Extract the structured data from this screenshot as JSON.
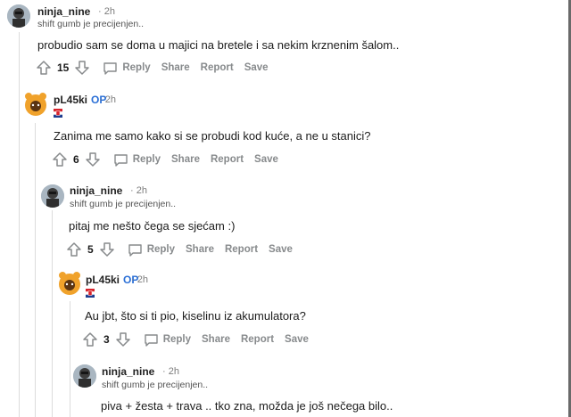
{
  "comments": [
    {
      "username": "ninja_nine",
      "op_badge": "",
      "time": "2h",
      "flair": "shift gumb je precijenjen..",
      "body": "probudio sam se doma u majici na bretele i sa nekim krznenim šalom..",
      "score": "15",
      "reply": "Reply",
      "share": "Share",
      "report": "Report",
      "save": "Save"
    },
    {
      "username": "pL45ki",
      "op_badge": "OP",
      "time": "2h",
      "flair": "",
      "body": "Zanima me samo kako si se probudi kod kuće, a ne u stanici?",
      "score": "6",
      "reply": "Reply",
      "share": "Share",
      "report": "Report",
      "save": "Save"
    },
    {
      "username": "ninja_nine",
      "op_badge": "",
      "time": "2h",
      "flair": "shift gumb je precijenjen..",
      "body": "pitaj me nešto čega se sjećam :)",
      "score": "5",
      "reply": "Reply",
      "share": "Share",
      "report": "Report",
      "save": "Save"
    },
    {
      "username": "pL45ki",
      "op_badge": "OP",
      "time": "2h",
      "flair": "",
      "body": "Au jbt, što si ti pio, kiselinu iz akumulatora?",
      "score": "3",
      "reply": "Reply",
      "share": "Share",
      "report": "Report",
      "save": "Save"
    },
    {
      "username": "ninja_nine",
      "op_badge": "",
      "time": "2h",
      "flair": "shift gumb je precijenjen..",
      "body": "piva + žesta + trava .. tko zna, možda je još nečega bilo..",
      "score": "",
      "reply": "",
      "share": "",
      "report": "",
      "save": ""
    }
  ],
  "separator": "·",
  "colors": {
    "op_badge": "#2a6fd6",
    "thread_line": "#dcdcdc",
    "action_text": "#878a8c"
  },
  "icons": {
    "upvote": "arrow-up-outline-icon",
    "downvote": "arrow-down-outline-icon",
    "reply": "speech-bubble-icon",
    "flag": "croatia-flag-icon"
  }
}
